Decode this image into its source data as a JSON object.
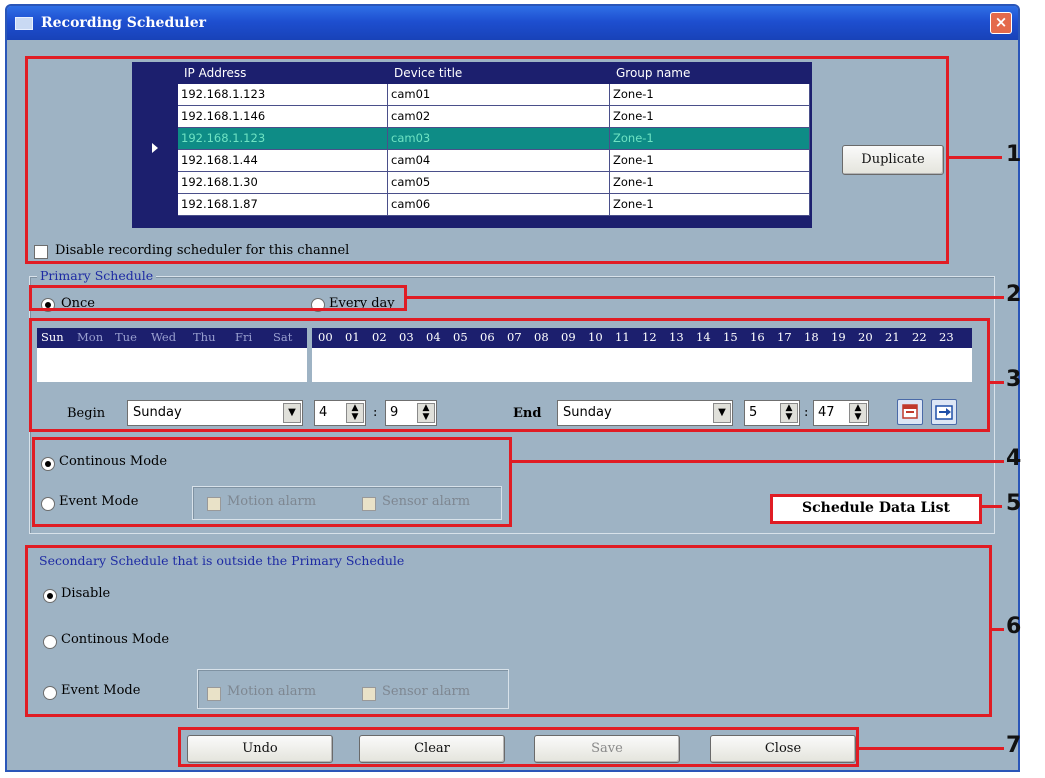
{
  "window": {
    "title": "Recording Scheduler",
    "close_glyph": "×"
  },
  "device_table": {
    "columns": [
      "IP Address",
      "Device title",
      "Group name"
    ],
    "rows": [
      {
        "ip": "192.168.1.123",
        "title": "cam01",
        "group": "Zone-1"
      },
      {
        "ip": "192.168.1.146",
        "title": "cam02",
        "group": "Zone-1"
      },
      {
        "ip": "192.168.1.123",
        "title": "cam03",
        "group": "Zone-1"
      },
      {
        "ip": "192.168.1.44",
        "title": "cam04",
        "group": "Zone-1"
      },
      {
        "ip": "192.168.1.30",
        "title": "cam05",
        "group": "Zone-1"
      },
      {
        "ip": "192.168.1.87",
        "title": "cam06",
        "group": "Zone-1"
      }
    ],
    "selected_row": 3
  },
  "duplicate_button": "Duplicate",
  "disable_checkbox_label": "Disable recording scheduler for this channel",
  "primary": {
    "group_label": "Primary Schedule",
    "once_label": "Once",
    "everyday_label": "Every day",
    "days": [
      "Sun",
      "Mon",
      "Tue",
      "Wed",
      "Thu",
      "Fri",
      "Sat"
    ],
    "hours": [
      "00",
      "01",
      "02",
      "03",
      "04",
      "05",
      "06",
      "07",
      "08",
      "09",
      "10",
      "11",
      "12",
      "13",
      "14",
      "15",
      "16",
      "17",
      "18",
      "19",
      "20",
      "21",
      "22",
      "23"
    ],
    "begin_label": "Begin",
    "begin_day": "Sunday",
    "begin_hour": "4",
    "begin_minute": "9",
    "colon": ":",
    "end_label": "End",
    "end_day": "Sunday",
    "end_hour": "5",
    "end_minute": "47",
    "continuous_label": "Continous Mode",
    "event_label": "Event Mode",
    "motion_label": "Motion alarm",
    "sensor_label": "Sensor alarm"
  },
  "schedule_data_list_label": "Schedule Data List",
  "secondary": {
    "group_label": "Secondary Schedule that is outside the Primary Schedule",
    "disable_label": "Disable",
    "continuous_label": "Continous Mode",
    "event_label": "Event Mode",
    "motion_label": "Motion alarm",
    "sensor_label": "Sensor alarm"
  },
  "footer": {
    "undo": "Undo",
    "clear": "Clear",
    "save": "Save",
    "close": "Close"
  },
  "callouts": [
    "1",
    "2",
    "3",
    "4",
    "5",
    "6",
    "7"
  ],
  "colors": {
    "window_bg": "#9eb3c4",
    "grid_header": "#1c1f6e",
    "selected_row": "#0e8c86",
    "callout_red": "#e01c24",
    "titlebar_blue": "#1e4fd0"
  }
}
